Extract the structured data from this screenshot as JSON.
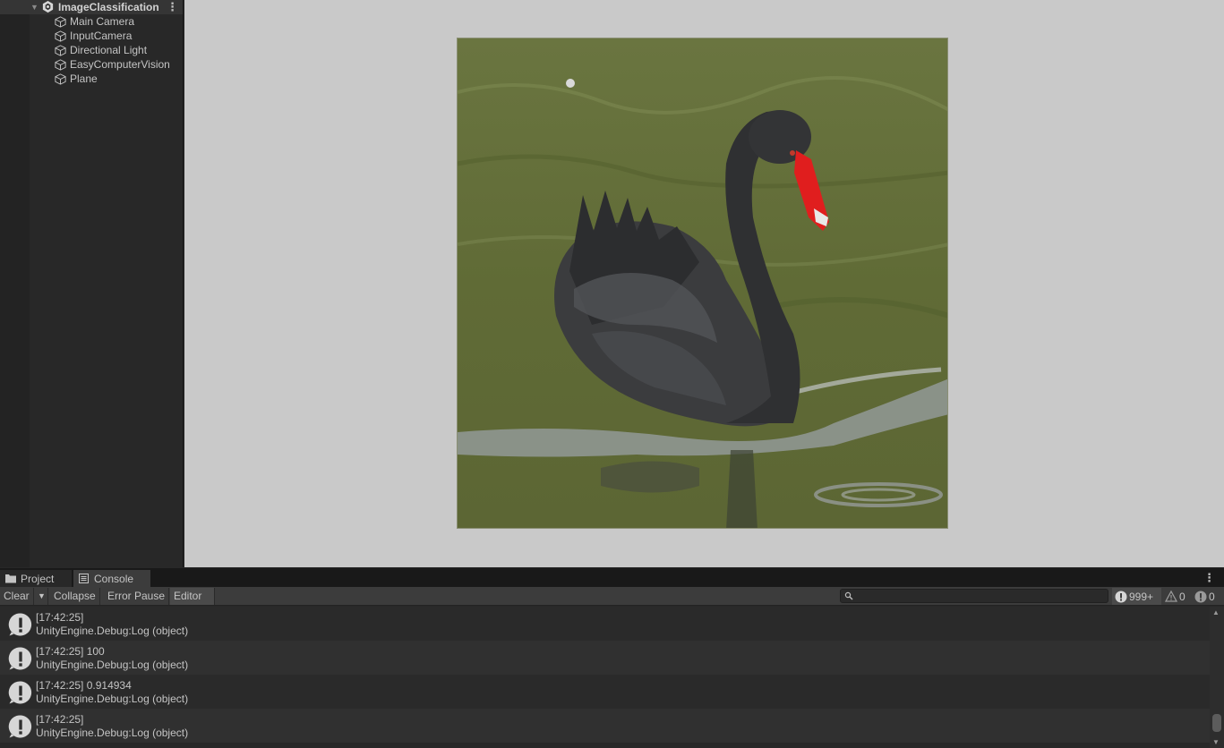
{
  "hierarchy": {
    "scene_name": "ImageClassification",
    "items": [
      {
        "label": "Main Camera",
        "icon": "gameobject-cube-icon"
      },
      {
        "label": "InputCamera",
        "icon": "gameobject-cube-icon"
      },
      {
        "label": "Directional Light",
        "icon": "gameobject-cube-icon"
      },
      {
        "label": "EasyComputerVision",
        "icon": "gameobject-cube-icon"
      },
      {
        "label": "Plane",
        "icon": "gameobject-cube-icon"
      }
    ]
  },
  "game_view": {
    "image_subject": "black-swan-photo"
  },
  "bottom_panel": {
    "tabs": [
      {
        "label": "Project",
        "icon": "folder-icon",
        "active": false
      },
      {
        "label": "Console",
        "icon": "console-list-icon",
        "active": true
      }
    ],
    "toolbar": {
      "clear_label": "Clear",
      "collapse_label": "Collapse",
      "error_pause_label": "Error Pause",
      "editor_label": "Editor",
      "search_value": "",
      "log_count": "999+",
      "warning_count": "0",
      "error_count": "0"
    },
    "logs": [
      {
        "line1": "[17:42:25]",
        "line2": "UnityEngine.Debug:Log (object)"
      },
      {
        "line1": "[17:42:25] 100",
        "line2": "UnityEngine.Debug:Log (object)"
      },
      {
        "line1": "[17:42:25] 0.914934",
        "line2": "UnityEngine.Debug:Log (object)"
      },
      {
        "line1": "[17:42:25]",
        "line2": "UnityEngine.Debug:Log (object)"
      }
    ]
  },
  "colors": {
    "editor_bg": "#282828",
    "game_bg": "#c9c9c9",
    "swan_beak": "#e01e1e",
    "water": "#5f6a37"
  }
}
